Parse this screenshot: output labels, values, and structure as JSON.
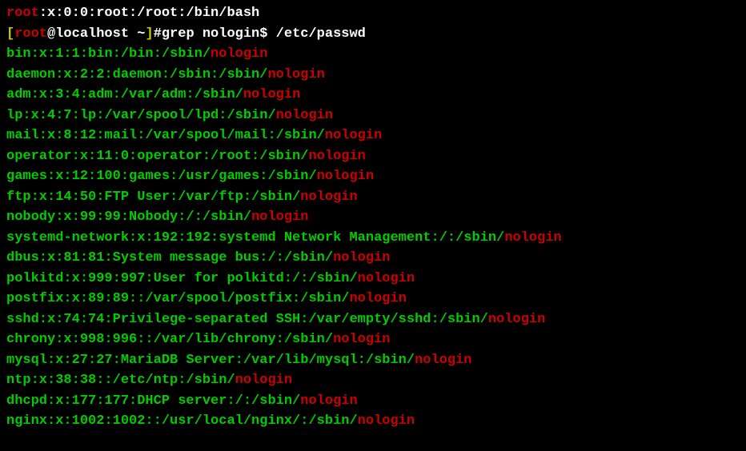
{
  "line1": {
    "user": "root",
    "rest": ":x:0:0:root:/root:/bin/bash"
  },
  "prompt": {
    "bracket_open": "[",
    "user": "root",
    "at_host": "@localhost ~",
    "bracket_close": "]",
    "hash": "#",
    "command": "grep nologin$ /etc/passwd"
  },
  "entries": [
    {
      "prefix": "bin:x:1:1:bin:/bin:/sbin/",
      "match": "nologin"
    },
    {
      "prefix": "daemon:x:2:2:daemon:/sbin:/sbin/",
      "match": "nologin"
    },
    {
      "prefix": "adm:x:3:4:adm:/var/adm:/sbin/",
      "match": "nologin"
    },
    {
      "prefix": "lp:x:4:7:lp:/var/spool/lpd:/sbin/",
      "match": "nologin"
    },
    {
      "prefix": "mail:x:8:12:mail:/var/spool/mail:/sbin/",
      "match": "nologin"
    },
    {
      "prefix": "operator:x:11:0:operator:/root:/sbin/",
      "match": "nologin"
    },
    {
      "prefix": "games:x:12:100:games:/usr/games:/sbin/",
      "match": "nologin"
    },
    {
      "prefix": "ftp:x:14:50:FTP User:/var/ftp:/sbin/",
      "match": "nologin"
    },
    {
      "prefix": "nobody:x:99:99:Nobody:/:/sbin/",
      "match": "nologin"
    },
    {
      "prefix": "systemd-network:x:192:192:systemd Network Management:/:/sbin/",
      "match": "nologin"
    },
    {
      "prefix": "dbus:x:81:81:System message bus:/:/sbin/",
      "match": "nologin"
    },
    {
      "prefix": "polkitd:x:999:997:User for polkitd:/:/sbin/",
      "match": "nologin"
    },
    {
      "prefix": "postfix:x:89:89::/var/spool/postfix:/sbin/",
      "match": "nologin"
    },
    {
      "prefix": "sshd:x:74:74:Privilege-separated SSH:/var/empty/sshd:/sbin/",
      "match": "nologin"
    },
    {
      "prefix": "chrony:x:998:996::/var/lib/chrony:/sbin/",
      "match": "nologin"
    },
    {
      "prefix": "mysql:x:27:27:MariaDB Server:/var/lib/mysql:/sbin/",
      "match": "nologin"
    },
    {
      "prefix": "ntp:x:38:38::/etc/ntp:/sbin/",
      "match": "nologin"
    },
    {
      "prefix": "dhcpd:x:177:177:DHCP server:/:/sbin/",
      "match": "nologin"
    },
    {
      "prefix": "nginx:x:1002:1002::/usr/local/nginx/:/sbin/",
      "match": "nologin"
    }
  ]
}
